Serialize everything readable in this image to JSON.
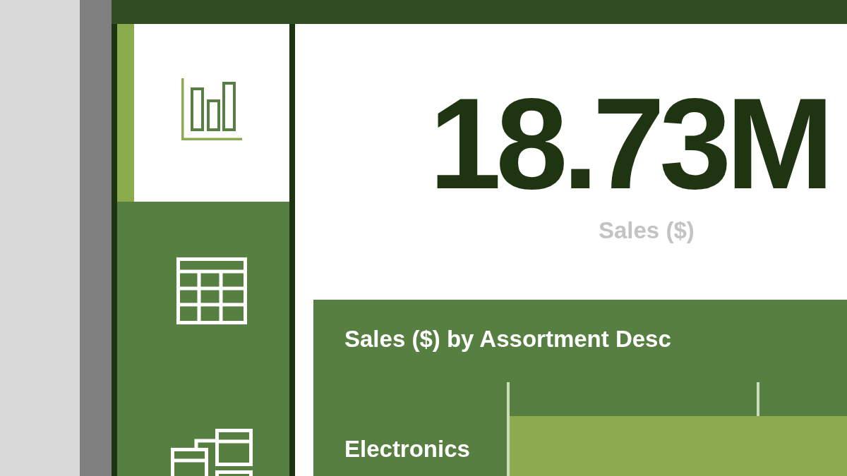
{
  "sidebar": {
    "items": [
      {
        "selected": true
      },
      {
        "selected": false
      },
      {
        "selected": false
      }
    ]
  },
  "kpi": {
    "value": "18.73M",
    "label": "Sales ($)"
  },
  "bar_chart": {
    "title": "Sales ($) by Assortment Desc",
    "bars": [
      {
        "label": "Electronics"
      }
    ]
  }
}
